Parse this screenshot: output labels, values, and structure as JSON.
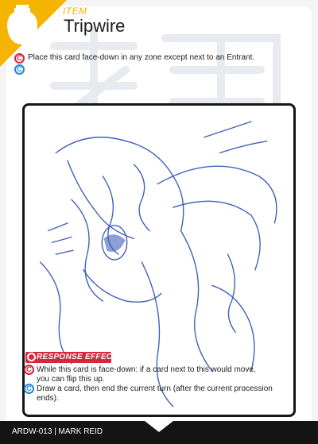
{
  "card": {
    "type_label": "ITEM",
    "name": "Tripwire",
    "ability_icons": {
      "red": "C",
      "blue": "C"
    },
    "ability_text": "Place this card face-down in any zone except next to an Entrant.",
    "response": {
      "header": "RESPONSE EFFECT",
      "line1": "While this card is face-down: if a card next to this would move,",
      "line2": "you can flip this up.",
      "line3": "Draw a card, then end the current turn (after the current procession",
      "line4": "ends)."
    },
    "footer": "ARDW-013 | MARK REID",
    "colors": {
      "accent_gold": "#f5b400",
      "red": "#d7263d",
      "blue": "#1e88e5",
      "frame": "#141414",
      "sketch": "#2b4fb0"
    },
    "icons": [
      "vase-icon",
      "cost-red-icon",
      "cost-blue-icon",
      "response-icon"
    ]
  }
}
